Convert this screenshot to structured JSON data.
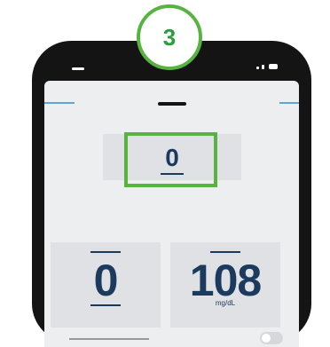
{
  "step": {
    "number": "3"
  },
  "fields": {
    "top_value": "0",
    "left_value": "0",
    "right_value": "108",
    "right_unit": "mg/dL"
  },
  "colors": {
    "highlight": "#57b441",
    "accent": "#5aa7d9",
    "value_text": "#1c3a5e",
    "phone_body": "#141414"
  },
  "icons": [
    "status-bars-icon",
    "battery-icon"
  ],
  "toggle": {
    "state": "off"
  }
}
